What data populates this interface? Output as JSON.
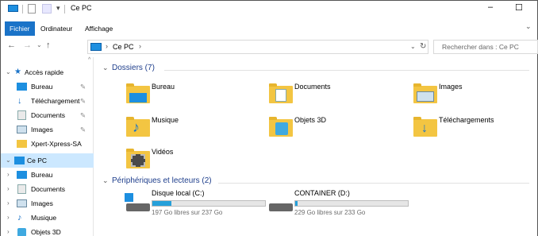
{
  "window": {
    "title": "Ce PC",
    "minimize": "–",
    "maximize": "☐"
  },
  "ribbon": {
    "tabs": [
      "Fichier",
      "Ordinateur",
      "Affichage"
    ],
    "expand": "⌄"
  },
  "address": {
    "path_root": "Ce PC",
    "search_placeholder": "Rechercher dans : Ce PC"
  },
  "nav": {
    "quick_access": "Accès rapide",
    "pinned": [
      "Bureau",
      "Téléchargements",
      "Documents",
      "Images"
    ],
    "recent": [
      "Xpert-Xpress-SA"
    ],
    "this_pc": "Ce PC",
    "pc_items": [
      "Bureau",
      "Documents",
      "Images",
      "Musique",
      "Objets 3D"
    ]
  },
  "folders": {
    "header": "Dossiers (7)",
    "items": [
      "Bureau",
      "Documents",
      "Images",
      "Musique",
      "Objets 3D",
      "Téléchargements",
      "Vidéos"
    ]
  },
  "devices": {
    "header": "Périphériques et lecteurs (2)",
    "items": [
      {
        "name": "Disque local (C:)",
        "free": "197 Go libres sur 237 Go",
        "used_fraction": 0.17
      },
      {
        "name": "CONTAINER (D:)",
        "free": "229 Go libres sur 233 Go",
        "used_fraction": 0.02
      }
    ]
  },
  "colors": {
    "accent": "#1a73c8",
    "selected": "#cce8ff",
    "group_header": "#1e3e8c",
    "bar_fill": "#26a0da"
  }
}
